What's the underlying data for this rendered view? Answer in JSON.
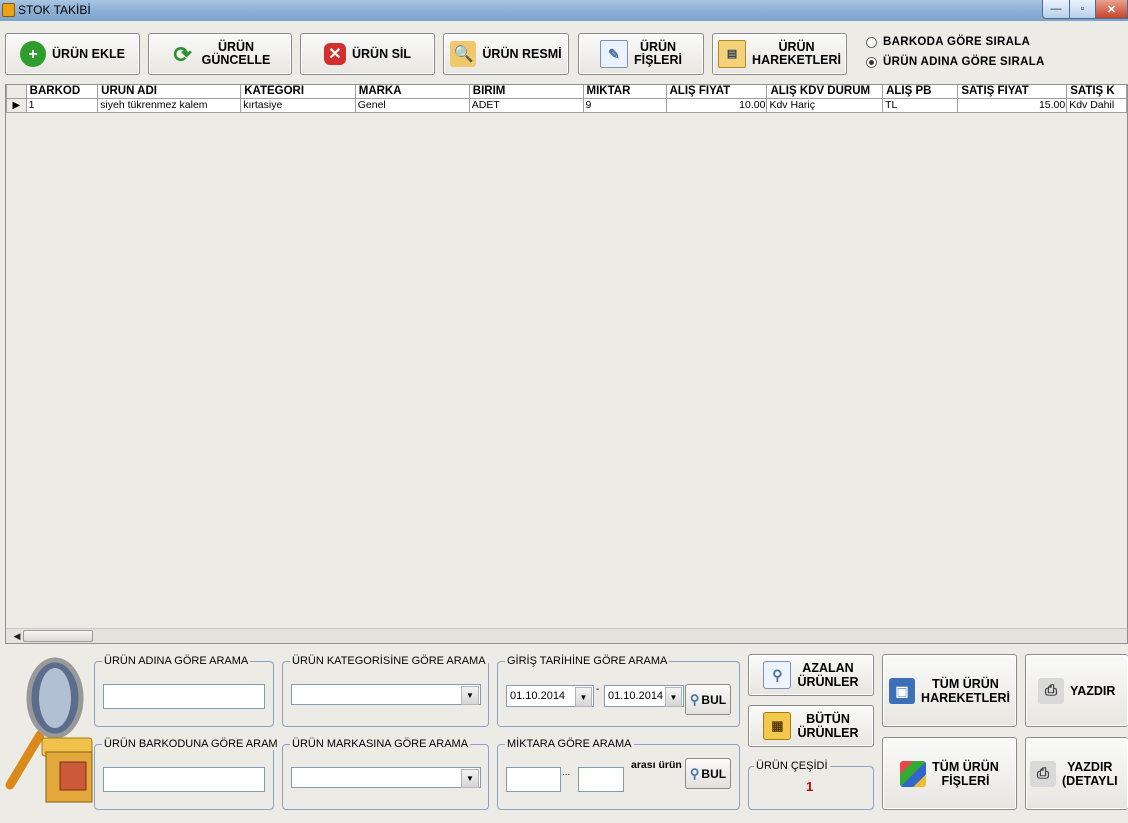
{
  "window": {
    "title": "STOK TAKİBİ",
    "min": "—",
    "max": "▫",
    "close": "✕"
  },
  "toolbar": {
    "add": "ÜRÜN EKLE",
    "update_l1": "ÜRÜN",
    "update_l2": "GÜNCELLE",
    "delete": "ÜRÜN SİL",
    "image": "ÜRÜN RESMİ",
    "slips_l1": "ÜRÜN",
    "slips_l2": "FİŞLERİ",
    "moves_l1": "ÜRÜN",
    "moves_l2": "HAREKETLERİ"
  },
  "sort": {
    "by_barcode": "BARKODA GÖRE SIRALA",
    "by_name": "ÜRÜN ADINA GÖRE SIRALA",
    "selected": "by_name"
  },
  "grid": {
    "columns": [
      "BARKOD",
      "ÜRÜN ADI",
      "KATEGORİ",
      "MARKA",
      "BİRİM",
      "MİKTAR",
      "ALIŞ FİYAT",
      "ALIŞ KDV DURUM",
      "ALIŞ PB",
      "SATIŞ FİYAT",
      "SATIŞ K"
    ],
    "rows": [
      [
        "1",
        "siyeh tükrenmez kalem",
        "kırtasiye",
        "Genel",
        "ADET",
        "9",
        "10.00",
        "Kdv Hariç",
        "TL",
        "15.00",
        "Kdv Dahil"
      ]
    ]
  },
  "search": {
    "name_label": "ÜRÜN ADINA GÖRE ARAMA",
    "barcode_label": "ÜRÜN BARKODUNA GÖRE ARAM",
    "category_label": "ÜRÜN KATEGORİSİNE GÖRE ARAMA",
    "brand_label": "ÜRÜN MARKASINA GÖRE ARAMA",
    "date_label": "GİRİŞ TARİHİNE GÖRE ARAMA",
    "date_from": "01.10.2014",
    "date_to": "01.10.2014",
    "date_sep": "-",
    "qty_label": "MİKTARA GÖRE ARAMA",
    "qty_sep": "...",
    "qty_suffix": "arası ürün",
    "find": "BUL"
  },
  "actions": {
    "low_l1": "AZALAN",
    "low_l2": "ÜRÜNLER",
    "all_l1": "BÜTÜN",
    "all_l2": "ÜRÜNLER",
    "variety_label": "ÜRÜN ÇEŞİDİ",
    "variety_count": "1",
    "all_moves_l1": "TÜM ÜRÜN",
    "all_moves_l2": "HAREKETLERİ",
    "all_slips_l1": "TÜM ÜRÜN",
    "all_slips_l2": "FİŞLERİ",
    "print": "YAZDIR",
    "print_detail_l1": "YAZDIR",
    "print_detail_l2": "(DETAYLI"
  },
  "colors": {
    "titlebar": "#8fb2d6",
    "accent_red": "#c0392b",
    "group_border": "#8ea2c8",
    "count_red": "#c00000"
  }
}
